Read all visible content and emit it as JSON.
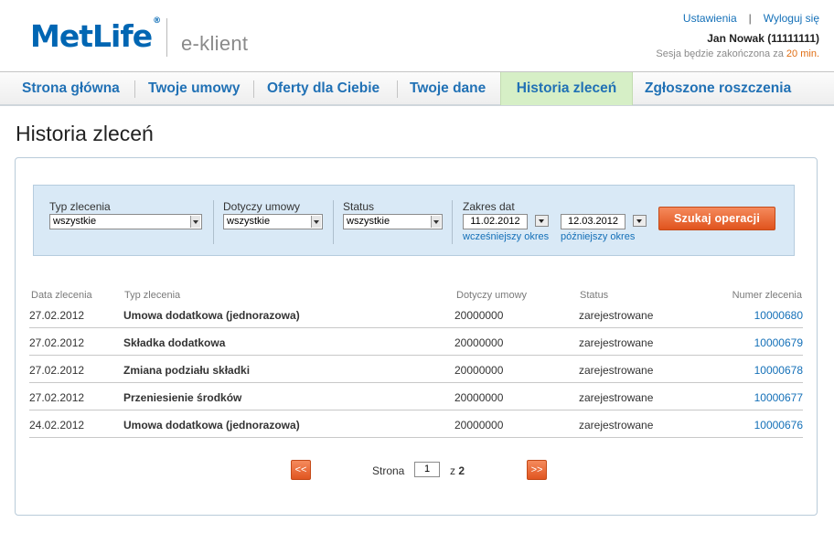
{
  "header": {
    "logo_text": "MetLife",
    "logo_mark": "®",
    "product": "e-klient",
    "settings_link": "Ustawienia",
    "separator": "|",
    "logout_link": "Wyloguj się",
    "user": "Jan Nowak (11111111)",
    "session_prefix": "Sesja będzie zakończona za",
    "session_minutes": "20 min.",
    "accent_color": "#e06d12"
  },
  "nav": {
    "tabs": [
      {
        "label": "Strona główna"
      },
      {
        "label": "Twoje umowy"
      },
      {
        "label": "Oferty dla Ciebie"
      },
      {
        "label": "Twoje dane"
      },
      {
        "label": "Historia zleceń",
        "active": true
      },
      {
        "label": "Zgłoszone roszczenia"
      }
    ],
    "active_color": "#d6efc6"
  },
  "page": {
    "title": "Historia zleceń"
  },
  "filter": {
    "type_label": "Typ zlecenia",
    "type_value": "wszystkie",
    "contract_label": "Dotyczy umowy",
    "contract_value": "wszystkie",
    "status_label": "Status",
    "status_value": "wszystkie",
    "date_label": "Zakres dat",
    "date_from": "11.02.2012",
    "date_to": "12.03.2012",
    "earlier_link": "wcześniejszy okres",
    "later_link": "późniejszy okres",
    "search_button": "Szukaj operacji",
    "button_color": "#e0531d"
  },
  "table": {
    "headers": [
      "Data zlecenia",
      "Typ zlecenia",
      "Dotyczy umowy",
      "Status",
      "Numer zlecenia"
    ],
    "rows": [
      {
        "date": "27.02.2012",
        "type": "Umowa dodatkowa (jednorazowa)",
        "contract": "20000000",
        "status": "zarejestrowane",
        "number": "10000680"
      },
      {
        "date": "27.02.2012",
        "type": "Składka dodatkowa",
        "contract": "20000000",
        "status": "zarejestrowane",
        "number": "10000679"
      },
      {
        "date": "27.02.2012",
        "type": "Zmiana podziału składki",
        "contract": "20000000",
        "status": "zarejestrowane",
        "number": "10000678"
      },
      {
        "date": "27.02.2012",
        "type": "Przeniesienie środków",
        "contract": "20000000",
        "status": "zarejestrowane",
        "number": "10000677"
      },
      {
        "date": "24.02.2012",
        "type": "Umowa dodatkowa (jednorazowa)",
        "contract": "20000000",
        "status": "zarejestrowane",
        "number": "10000676"
      }
    ]
  },
  "pagination": {
    "prev": "<<",
    "next": ">>",
    "page_label": "Strona",
    "current": "1",
    "of_label": "z",
    "total": "2"
  }
}
